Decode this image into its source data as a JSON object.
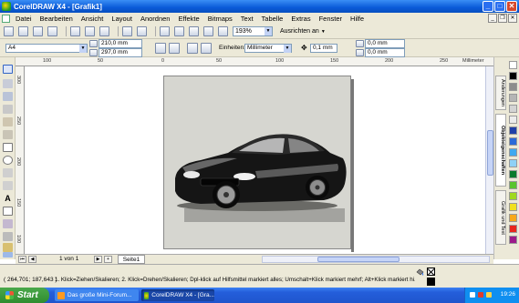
{
  "window": {
    "title": "CorelDRAW X4 - [Grafik1]"
  },
  "menu": [
    "Datei",
    "Bearbeiten",
    "Ansicht",
    "Layout",
    "Anordnen",
    "Effekte",
    "Bitmaps",
    "Text",
    "Tabelle",
    "Extras",
    "Fenster",
    "Hilfe"
  ],
  "toolbar": {
    "zoom": "193%",
    "align_label": "Ausrichten an"
  },
  "propbar": {
    "page_size": "A4",
    "width": "210,0 mm",
    "height": "297,0 mm",
    "units_label": "Einheiten:",
    "units_value": "Millimeter",
    "nudge": "0,1 mm",
    "dup_x": "0,0 mm",
    "dup_y": "0,0 mm"
  },
  "ruler": {
    "h_ticks": [
      "100",
      "50",
      "0",
      "50",
      "100",
      "150",
      "200",
      "250",
      "300"
    ],
    "h_unit": "Millimeter",
    "v_ticks": [
      "300",
      "250",
      "200",
      "150",
      "100"
    ]
  },
  "docker": {
    "tabs": [
      "Änderungen",
      "Objekteigenschaften",
      "Grafik und Text"
    ]
  },
  "palette": [
    "#ffffff",
    "#000000",
    "#8d8d8d",
    "#b5b5b5",
    "#d4d4d4",
    "#ececec",
    "#1f3fa8",
    "#2a69d8",
    "#3fa9f0",
    "#8fd1f6",
    "#0a7a2e",
    "#58c42f",
    "#a0d820",
    "#f0e020",
    "#f7a81a",
    "#e8261d",
    "#9c1a8a"
  ],
  "pagenav": {
    "count": "1 von 1",
    "tab": "Seite1"
  },
  "status": {
    "coords": "( 264,701; 187,643 )",
    "hint": "1. Klick=Ziehen/Skalieren; 2. Klick=Drehen/Skalieren; Dpl-klick auf Hilfsmittel markiert alles; Umschalt+Klick markiert mehrf; Alt+Klick markiert hi..."
  },
  "taskbar": {
    "start": "Start",
    "tasks": [
      "Das große Mini-Forum...",
      "CorelDRAW X4 - [Gra..."
    ],
    "clock": "19:26"
  }
}
